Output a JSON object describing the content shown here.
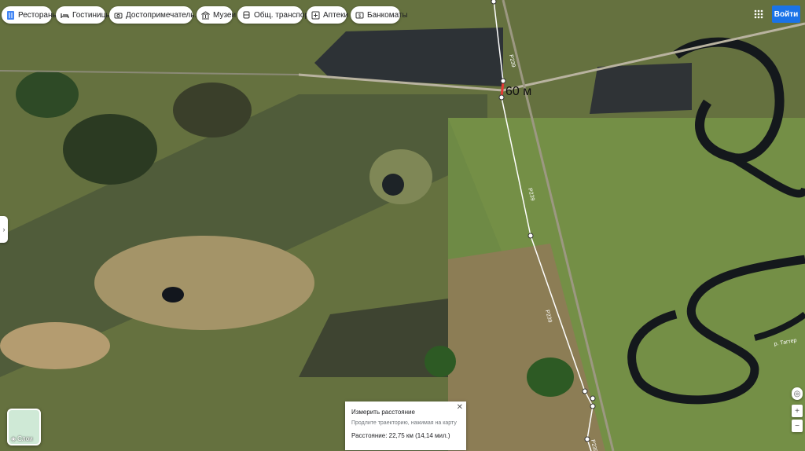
{
  "chips": [
    {
      "label": "Рестораны",
      "icon": "fork-knife-icon"
    },
    {
      "label": "Гостиницы",
      "icon": "bed-icon"
    },
    {
      "label": "Достопримечатель...",
      "icon": "camera-icon"
    },
    {
      "label": "Музеи",
      "icon": "museum-icon"
    },
    {
      "label": "Общ. транспорт",
      "icon": "bus-icon"
    },
    {
      "label": "Аптеки",
      "icon": "pharmacy-icon"
    },
    {
      "label": "Банкоматы",
      "icon": "atm-icon"
    }
  ],
  "header": {
    "signin_label": "Войти",
    "apps_icon": "apps-grid-icon"
  },
  "map": {
    "segment_label": "60 м",
    "road_labels": [
      "Р239",
      "Р239",
      "Р239",
      "Р239"
    ],
    "river_label": "р. Тагтер"
  },
  "measure": {
    "title": "Измерить расстояние",
    "hint": "Продлите траекторию, нажимая на карту",
    "distance": "Расстояние: 22,75 км (14,14 мил.)",
    "close_icon": "close-icon"
  },
  "layers": {
    "label": "Слои",
    "icon": "layers-icon"
  },
  "controls": {
    "locate_icon": "compass-icon",
    "zoom_in": "+",
    "zoom_out": "−"
  },
  "colors": {
    "accent": "#1a73e8",
    "measure_line": "#ffffff",
    "segment": "#e53935"
  }
}
